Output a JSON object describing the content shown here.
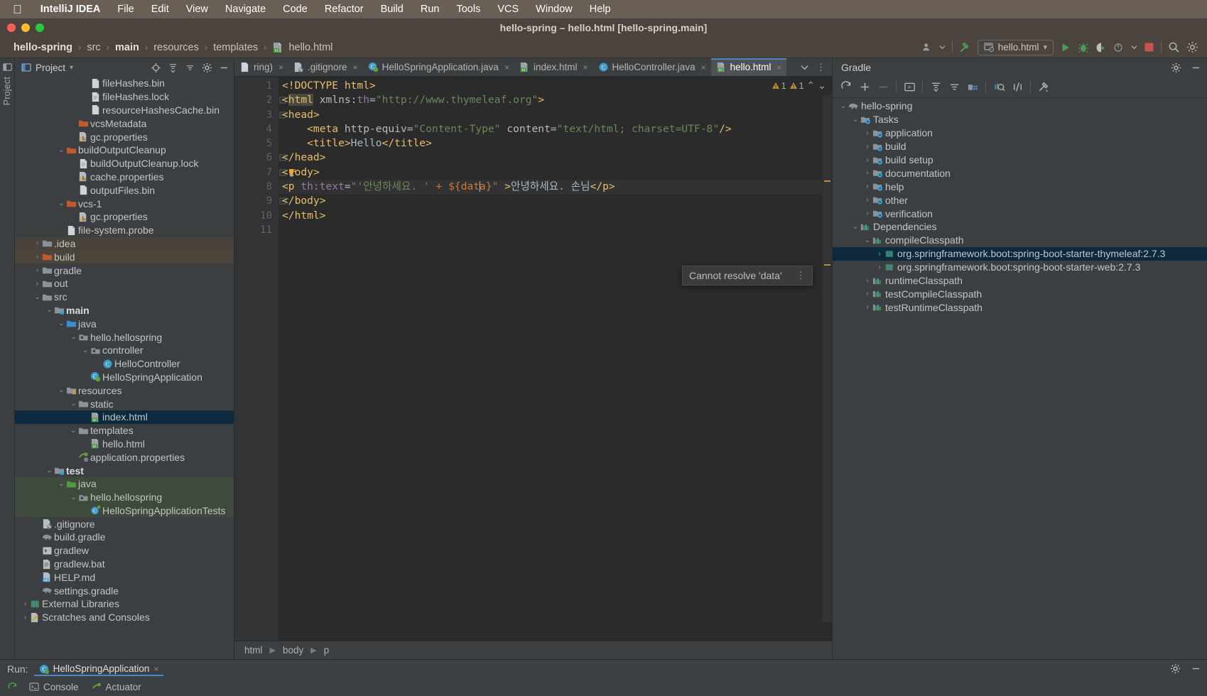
{
  "mac_menu": {
    "apple_icon": "apple-logo-icon",
    "app_name": "IntelliJ IDEA",
    "items": [
      "File",
      "Edit",
      "View",
      "Navigate",
      "Code",
      "Refactor",
      "Build",
      "Run",
      "Tools",
      "VCS",
      "Window",
      "Help"
    ]
  },
  "window": {
    "title": "hello-spring – hello.html [hello-spring.main]",
    "traffic_lights": [
      "close-button",
      "minimize-button",
      "maximize-button"
    ]
  },
  "navbar": {
    "breadcrumbs": [
      {
        "label": "hello-spring",
        "bold": true
      },
      {
        "label": "src",
        "bold": false
      },
      {
        "label": "main",
        "bold": true
      },
      {
        "label": "resources",
        "bold": false
      },
      {
        "label": "templates",
        "bold": false
      },
      {
        "label": "hello.html",
        "bold": false,
        "icon": "html-file-icon"
      }
    ],
    "separator": "›",
    "right_icons": [
      "user-account-icon",
      "chevron-down-icon",
      "build-hammer-icon"
    ],
    "run_config": {
      "label": "hello.html",
      "icon": "html-run-config-icon",
      "chevron": "▾"
    },
    "actions": [
      "run-button",
      "debug-button",
      "run-with-coverage-button",
      "profile-button",
      "stop-button",
      "search-everywhere-icon",
      "settings-gear-icon"
    ]
  },
  "left_strip": {
    "vertical_tabs": [
      "Project"
    ]
  },
  "project_panel": {
    "title": "Project",
    "chevron": "▾",
    "icons": [
      "locate-icon",
      "expand-all-icon",
      "collapse-all-icon",
      "settings-gear-icon",
      "hide-icon"
    ],
    "tree": [
      {
        "label": "fileHashes.bin",
        "indent": 5,
        "arrow": "",
        "icon": "binary-file-icon",
        "state": ""
      },
      {
        "label": "fileHashes.lock",
        "indent": 5,
        "arrow": "",
        "icon": "text-file-icon",
        "state": ""
      },
      {
        "label": "resourceHashesCache.bin",
        "indent": 5,
        "arrow": "",
        "icon": "binary-file-icon",
        "state": ""
      },
      {
        "label": "vcsMetadata",
        "indent": 4,
        "arrow": "",
        "icon": "orange-folder-icon",
        "state": ""
      },
      {
        "label": "gc.properties",
        "indent": 4,
        "arrow": "",
        "icon": "properties-file-icon",
        "state": ""
      },
      {
        "label": "buildOutputCleanup",
        "indent": 3,
        "arrow": "⌄",
        "icon": "orange-folder-icon",
        "state": ""
      },
      {
        "label": "buildOutputCleanup.lock",
        "indent": 4,
        "arrow": "",
        "icon": "text-file-icon",
        "state": ""
      },
      {
        "label": "cache.properties",
        "indent": 4,
        "arrow": "",
        "icon": "properties-file-icon",
        "state": ""
      },
      {
        "label": "outputFiles.bin",
        "indent": 4,
        "arrow": "",
        "icon": "binary-file-icon",
        "state": ""
      },
      {
        "label": "vcs-1",
        "indent": 3,
        "arrow": "⌄",
        "icon": "orange-folder-icon",
        "state": ""
      },
      {
        "label": "gc.properties",
        "indent": 4,
        "arrow": "",
        "icon": "properties-file-icon",
        "state": ""
      },
      {
        "label": "file-system.probe",
        "indent": 3,
        "arrow": "",
        "icon": "binary-file-icon",
        "state": ""
      },
      {
        "label": ".idea",
        "indent": 1,
        "arrow": "›",
        "icon": "grey-folder-icon",
        "state": "hov"
      },
      {
        "label": "build",
        "indent": 1,
        "arrow": "›",
        "icon": "orange-folder-icon",
        "state": "brn"
      },
      {
        "label": "gradle",
        "indent": 1,
        "arrow": "›",
        "icon": "grey-folder-icon",
        "state": ""
      },
      {
        "label": "out",
        "indent": 1,
        "arrow": "›",
        "icon": "grey-folder-icon",
        "state": ""
      },
      {
        "label": "src",
        "indent": 1,
        "arrow": "⌄",
        "icon": "grey-folder-icon",
        "state": ""
      },
      {
        "label": "main",
        "indent": 2,
        "arrow": "⌄",
        "icon": "source-root-folder-icon",
        "state": "",
        "bold": true
      },
      {
        "label": "java",
        "indent": 3,
        "arrow": "⌄",
        "icon": "blue-folder-icon",
        "state": ""
      },
      {
        "label": "hello.hellospring",
        "indent": 4,
        "arrow": "⌄",
        "icon": "package-icon",
        "state": ""
      },
      {
        "label": "controller",
        "indent": 5,
        "arrow": "⌄",
        "icon": "package-icon",
        "state": ""
      },
      {
        "label": "HelloController",
        "indent": 6,
        "arrow": "",
        "icon": "java-class-icon",
        "state": ""
      },
      {
        "label": "HelloSpringApplication",
        "indent": 5,
        "arrow": "",
        "icon": "spring-class-icon",
        "state": ""
      },
      {
        "label": "resources",
        "indent": 3,
        "arrow": "⌄",
        "icon": "resources-root-folder-icon",
        "state": ""
      },
      {
        "label": "static",
        "indent": 4,
        "arrow": "⌄",
        "icon": "grey-folder-icon",
        "state": ""
      },
      {
        "label": "index.html",
        "indent": 5,
        "arrow": "",
        "icon": "html-file-icon",
        "state": "sel"
      },
      {
        "label": "templates",
        "indent": 4,
        "arrow": "⌄",
        "icon": "grey-folder-icon",
        "state": ""
      },
      {
        "label": "hello.html",
        "indent": 5,
        "arrow": "",
        "icon": "html-file-icon",
        "state": ""
      },
      {
        "label": "application.properties",
        "indent": 4,
        "arrow": "",
        "icon": "spring-properties-icon",
        "state": ""
      },
      {
        "label": "test",
        "indent": 2,
        "arrow": "⌄",
        "icon": "test-root-folder-icon",
        "state": "",
        "bold": true
      },
      {
        "label": "java",
        "indent": 3,
        "arrow": "⌄",
        "icon": "green-folder-icon",
        "state": "grn"
      },
      {
        "label": "hello.hellospring",
        "indent": 4,
        "arrow": "⌄",
        "icon": "package-icon",
        "state": "grn"
      },
      {
        "label": "HelloSpringApplicationTests",
        "indent": 5,
        "arrow": "",
        "icon": "test-class-icon",
        "state": "grn"
      },
      {
        "label": ".gitignore",
        "indent": 1,
        "arrow": "",
        "icon": "gitignore-icon",
        "state": ""
      },
      {
        "label": "build.gradle",
        "indent": 1,
        "arrow": "",
        "icon": "gradle-elephant-icon",
        "state": ""
      },
      {
        "label": "gradlew",
        "indent": 1,
        "arrow": "",
        "icon": "shell-script-icon",
        "state": ""
      },
      {
        "label": "gradlew.bat",
        "indent": 1,
        "arrow": "",
        "icon": "bat-script-icon",
        "state": ""
      },
      {
        "label": "HELP.md",
        "indent": 1,
        "arrow": "",
        "icon": "markdown-file-icon",
        "state": ""
      },
      {
        "label": "settings.gradle",
        "indent": 1,
        "arrow": "",
        "icon": "gradle-elephant-icon",
        "state": ""
      },
      {
        "label": "External Libraries",
        "indent": 0,
        "arrow": "›",
        "icon": "libraries-icon",
        "state": ""
      },
      {
        "label": "Scratches and Consoles",
        "indent": 0,
        "arrow": "›",
        "icon": "scratches-icon",
        "state": ""
      }
    ]
  },
  "editor": {
    "tabs": [
      {
        "label": "ring)",
        "icon": "clipped-tab-icon",
        "active": false,
        "close": "×"
      },
      {
        "label": ".gitignore",
        "icon": "gitignore-icon",
        "active": false,
        "close": "×"
      },
      {
        "label": "HelloSpringApplication.java",
        "icon": "spring-class-icon",
        "active": false,
        "close": "×"
      },
      {
        "label": "index.html",
        "icon": "html-file-icon",
        "active": false,
        "close": "×"
      },
      {
        "label": "HelloController.java",
        "icon": "java-class-icon",
        "active": false,
        "close": "×"
      },
      {
        "label": "hello.html",
        "icon": "html-file-icon",
        "active": true,
        "close": "×"
      }
    ],
    "tabbar_right": [
      "chevron-down-icon",
      "kebab-menu-icon"
    ],
    "inspections": {
      "warning_count_1": "1",
      "warning_count_2": "1",
      "up_arrow": "⌃",
      "down_arrow": "⌄"
    },
    "line_numbers": [
      "1",
      "2",
      "3",
      "4",
      "5",
      "6",
      "7",
      "8",
      "9",
      "10",
      "11"
    ],
    "code_lines": [
      {
        "n": 1,
        "segments": [
          {
            "t": "<!DOCTYPE html>",
            "c": "t-tag"
          }
        ]
      },
      {
        "n": 2,
        "segments": [
          {
            "t": "<",
            "c": "t-tag"
          },
          {
            "t": "html",
            "c": "t-tag hl-tag"
          },
          {
            "t": " ",
            "c": "t-txt"
          },
          {
            "t": "xmlns:",
            "c": "t-attr"
          },
          {
            "t": "th",
            "c": "t-attr2"
          },
          {
            "t": "=",
            "c": "t-txt"
          },
          {
            "t": "\"http://www.thymeleaf.org\"",
            "c": "t-str"
          },
          {
            "t": ">",
            "c": "t-tag"
          }
        ]
      },
      {
        "n": 3,
        "segments": [
          {
            "t": "<head>",
            "c": "t-tag"
          }
        ]
      },
      {
        "n": 4,
        "segments": [
          {
            "t": "    <meta ",
            "c": "t-tag"
          },
          {
            "t": "http-equiv",
            "c": "t-attr"
          },
          {
            "t": "=",
            "c": "t-txt"
          },
          {
            "t": "\"Content-Type\"",
            "c": "t-str"
          },
          {
            "t": " ",
            "c": "t-txt"
          },
          {
            "t": "content",
            "c": "t-attr"
          },
          {
            "t": "=",
            "c": "t-txt"
          },
          {
            "t": "\"text/html; charset=UTF-8\"",
            "c": "t-str"
          },
          {
            "t": "/>",
            "c": "t-tag"
          }
        ]
      },
      {
        "n": 5,
        "segments": [
          {
            "t": "    <title>",
            "c": "t-tag"
          },
          {
            "t": "Hello",
            "c": "t-txt"
          },
          {
            "t": "</title>",
            "c": "t-tag"
          }
        ]
      },
      {
        "n": 6,
        "segments": [
          {
            "t": "</head>",
            "c": "t-tag"
          }
        ]
      },
      {
        "n": 7,
        "segments": [
          {
            "t": "<body>",
            "c": "t-tag"
          }
        ]
      },
      {
        "n": 8,
        "segments": [
          {
            "t": "<p ",
            "c": "t-tag"
          },
          {
            "t": "th:text",
            "c": "t-attr2"
          },
          {
            "t": "=",
            "c": "t-txt"
          },
          {
            "t": "\"'안녕하세요. '",
            "c": "t-str"
          },
          {
            "t": " + ",
            "c": "t-pct"
          },
          {
            "t": "${",
            "c": "t-pct"
          },
          {
            "t": "data",
            "c": "t-pct err"
          },
          {
            "t": "}",
            "c": "t-pct"
          },
          {
            "t": "\"",
            "c": "t-str"
          },
          {
            "t": " >",
            "c": "t-tag"
          },
          {
            "t": "안녕하세요. 손님",
            "c": "t-txt"
          },
          {
            "t": "</p>",
            "c": "t-tag"
          }
        ]
      },
      {
        "n": 9,
        "segments": [
          {
            "t": "</body>",
            "c": "t-tag"
          }
        ]
      },
      {
        "n": 10,
        "segments": [
          {
            "t": "</html>",
            "c": "t-tag"
          }
        ]
      },
      {
        "n": 11,
        "segments": [
          {
            "t": "",
            "c": "t-txt"
          }
        ]
      }
    ],
    "raw_code": {
      "line1": "<!DOCTYPE html>",
      "line2": "<html xmlns:th=\"http://www.thymeleaf.org\">",
      "line3": "<head>",
      "line4": "    <meta http-equiv=\"Content-Type\" content=\"text/html; charset=UTF-8\"/>",
      "line5": "    <title>Hello</title>",
      "line6": "</head>",
      "line7": "<body>",
      "line8": "<p th:text=\"'안녕하세요. ' + ${data}\" >안녕하세요. 손님</p>",
      "line9": "</body>",
      "line10": "</html>"
    },
    "tooltip": {
      "message": "Cannot resolve 'data'",
      "kebab": "⋮"
    },
    "bottom_breadcrumbs": [
      "html",
      "body",
      "p"
    ],
    "bottom_sep": "›"
  },
  "gradle_panel": {
    "title": "Gradle",
    "header_icons": [
      "settings-gear-icon",
      "hide-icon"
    ],
    "toolbar_icons": [
      "refresh-icon",
      "add-icon",
      "remove-icon",
      "execute-task-icon",
      "expand-all-icon",
      "collapse-all-icon",
      "task-groups-icon",
      "run-anything-icon",
      "toggle-offline-icon",
      "build-tool-settings-icon"
    ],
    "tree": [
      {
        "label": "hello-spring",
        "indent": 0,
        "arrow": "⌄",
        "icon": "gradle-elephant-icon",
        "state": ""
      },
      {
        "label": "Tasks",
        "indent": 1,
        "arrow": "⌄",
        "icon": "task-folder-icon",
        "state": ""
      },
      {
        "label": "application",
        "indent": 2,
        "arrow": "›",
        "icon": "task-folder-icon",
        "state": ""
      },
      {
        "label": "build",
        "indent": 2,
        "arrow": "›",
        "icon": "task-folder-icon",
        "state": ""
      },
      {
        "label": "build setup",
        "indent": 2,
        "arrow": "›",
        "icon": "task-folder-icon",
        "state": ""
      },
      {
        "label": "documentation",
        "indent": 2,
        "arrow": "›",
        "icon": "task-folder-icon",
        "state": ""
      },
      {
        "label": "help",
        "indent": 2,
        "arrow": "›",
        "icon": "task-folder-icon",
        "state": ""
      },
      {
        "label": "other",
        "indent": 2,
        "arrow": "›",
        "icon": "task-folder-icon",
        "state": ""
      },
      {
        "label": "verification",
        "indent": 2,
        "arrow": "›",
        "icon": "task-folder-icon",
        "state": ""
      },
      {
        "label": "Dependencies",
        "indent": 1,
        "arrow": "⌄",
        "icon": "dependencies-icon",
        "state": ""
      },
      {
        "label": "compileClasspath",
        "indent": 2,
        "arrow": "⌄",
        "icon": "dependencies-icon",
        "state": ""
      },
      {
        "label": "org.springframework.boot:spring-boot-starter-thymeleaf:2.7.3",
        "indent": 3,
        "arrow": "›",
        "icon": "library-icon",
        "state": "sel"
      },
      {
        "label": "org.springframework.boot:spring-boot-starter-web:2.7.3",
        "indent": 3,
        "arrow": "›",
        "icon": "library-icon",
        "state": ""
      },
      {
        "label": "runtimeClasspath",
        "indent": 2,
        "arrow": "›",
        "icon": "dependencies-icon",
        "state": ""
      },
      {
        "label": "testCompileClasspath",
        "indent": 2,
        "arrow": "›",
        "icon": "dependencies-icon",
        "state": ""
      },
      {
        "label": "testRuntimeClasspath",
        "indent": 2,
        "arrow": "›",
        "icon": "dependencies-icon",
        "state": ""
      }
    ]
  },
  "run_bar": {
    "label": "Run:",
    "tab": {
      "label": "HelloSpringApplication",
      "icon": "spring-class-icon",
      "close": "×"
    },
    "right_icons": [
      "settings-gear-icon",
      "hide-icon"
    ]
  },
  "status_bar": {
    "items": [
      {
        "label": "Console",
        "icon": "console-icon"
      },
      {
        "label": "Actuator",
        "icon": "actuator-icon"
      }
    ],
    "left_icon": "restart-icon"
  },
  "colors": {
    "accent_blue": "#4a88c7",
    "selection_blue": "#0d293e",
    "warning_amber": "#bb9031",
    "run_green": "#499c54",
    "mac_bar": "#6a5f55",
    "panel_bg": "#3c3f41",
    "editor_bg": "#2b2b2b"
  }
}
